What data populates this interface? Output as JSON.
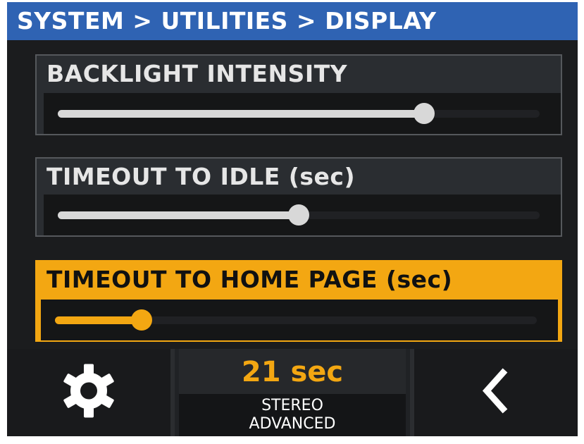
{
  "header": {
    "breadcrumb": "SYSTEM > UTILITIES > DISPLAY"
  },
  "settings": [
    {
      "label": "BACKLIGHT INTENSITY",
      "level": 0.76,
      "selected": false
    },
    {
      "label": "TIMEOUT TO IDLE (sec)",
      "level": 0.5,
      "selected": false
    },
    {
      "label": "TIMEOUT TO HOME PAGE (sec)",
      "level": 0.18,
      "selected": true
    }
  ],
  "footer": {
    "left_icon": "gear-icon",
    "status_value": "21 sec",
    "status_line1": "STEREO",
    "status_line2": "ADVANCED",
    "right_icon": "chevron-left-icon"
  },
  "colors": {
    "title_bar": "#2f63b3",
    "accent": "#f3a712",
    "slider_fill": "#d8d8d8",
    "background": "#111213"
  }
}
